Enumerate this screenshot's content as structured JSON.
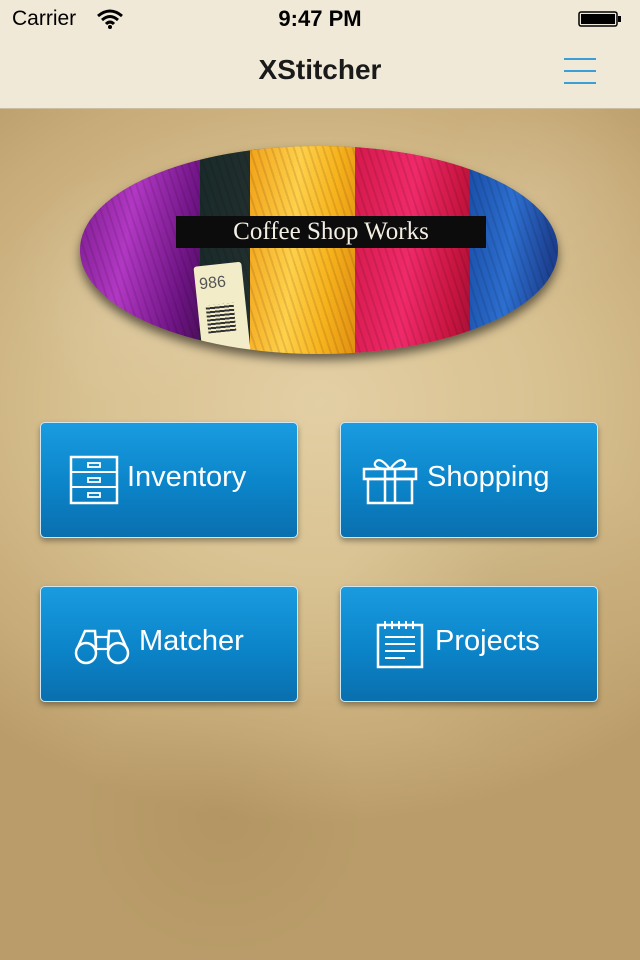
{
  "status_bar": {
    "carrier": "Carrier",
    "time": "9:47 PM"
  },
  "nav": {
    "title": "XStitcher",
    "menu_icon": "hamburger-menu-icon",
    "accent_color": "#3a9fd8"
  },
  "logo": {
    "caption": "Coffee Shop Works",
    "tag_number": "986"
  },
  "tiles": [
    {
      "label": "Inventory",
      "icon": "drawers-icon"
    },
    {
      "label": "Shopping",
      "icon": "gift-icon"
    },
    {
      "label": "Matcher",
      "icon": "binoculars-icon"
    },
    {
      "label": "Projects",
      "icon": "notepad-icon"
    }
  ],
  "colors": {
    "tile_blue": "#0b84c9",
    "bar_background": "#f1e9d8",
    "parchment": "#d8c191"
  }
}
